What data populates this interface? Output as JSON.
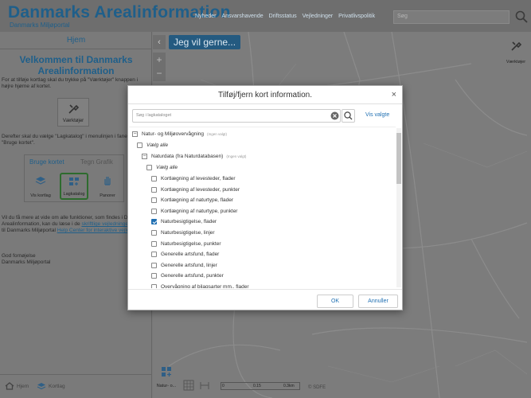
{
  "header": {
    "title": "Danmarks Arealinformation",
    "subtitle": "Danmarks Miljøportal",
    "nav": [
      "Nyheder",
      "Ansvarshavende",
      "Driftsstatus",
      "Vejledninger",
      "Privatlivspolitik"
    ],
    "search_placeholder": "Søg"
  },
  "sidebar": {
    "home_tab": "Hjem",
    "welcome": "Velkommen til Danmarks Arealinformation",
    "intro": "For at tilføje kortlag skal du trykke på \"Værktøjer\" knappen i højre hjørne af kortet.",
    "tools_label": "Værktøjer",
    "select_text": "Derefter skal du vælge \"Lagkatalog\" i menulinjen i fanebladet \"Bruge kortet\".",
    "tabs": [
      "Bruge kortet",
      "Tegn Grafik"
    ],
    "tab_items": [
      "Vis kortlag",
      "Lagkatalog",
      "Panorer"
    ],
    "more_text": "Vil du få mere at vide om alle funktioner, som findes i Danmarks Arealinformation, kan du læse i de ",
    "more_link1": "skriftlige vejledninger",
    "more_mid": " eller gå til Danmarks Miljøportal ",
    "more_link2": "Help Center for interaktive vejledning",
    "greeting": "God fornøjelse",
    "signature": "Danmarks Miljøportal",
    "bottom_home": "Hjem",
    "bottom_kortlag": "Kortlag"
  },
  "map": {
    "jeg_vil": "Jeg vil gerne...",
    "tools_label": "Værktøjer",
    "bottom_tool_label": "Natur- o...",
    "copyright": "© SDFE",
    "scale_labels": [
      "0",
      "0.15",
      "0.3km"
    ]
  },
  "modal": {
    "title": "Tilføj/fjern kort information.",
    "search_placeholder": "Søg i lagkataloget",
    "vis_valgte": "Vis valgte",
    "ok": "OK",
    "cancel": "Annuller",
    "tree": {
      "root": "Natur- og Miljøovervågning",
      "root_hint": "(Ingen valgt)",
      "root_select_all": "Vælg alle",
      "group": "Naturdata (fra Naturdatabasen)",
      "group_hint": "(Ingen valgt)",
      "group_select_all": "Vælg alle",
      "items": [
        {
          "label": "Kortlægning af levesteder, flader",
          "checked": false
        },
        {
          "label": "Kortlægning af levesteder, punkter",
          "checked": false
        },
        {
          "label": "Kortlægning af naturtype, flader",
          "checked": false
        },
        {
          "label": "Kortlægning af naturtype, punkter",
          "checked": false
        },
        {
          "label": "Naturbesigtigelse, flader",
          "checked": true
        },
        {
          "label": "Naturbesigtigelse, linjer",
          "checked": false
        },
        {
          "label": "Naturbesigtigelse, punkter",
          "checked": false
        },
        {
          "label": "Generelle artsfund, flader",
          "checked": false
        },
        {
          "label": "Generelle artsfund, linjer",
          "checked": false
        },
        {
          "label": "Generelle artsfund, punkter",
          "checked": false
        },
        {
          "label": "Overvågning af bilagsarter mm., flader",
          "checked": false
        }
      ]
    }
  }
}
